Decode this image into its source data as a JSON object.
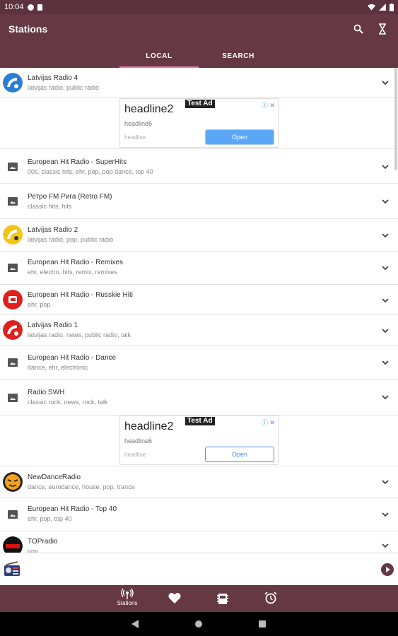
{
  "status_bar": {
    "time": "10:04"
  },
  "app_bar": {
    "title": "Stations"
  },
  "tabs": [
    {
      "label": "LOCAL",
      "active": true
    },
    {
      "label": "SEARCH",
      "active": false
    }
  ],
  "stations": [
    {
      "name": "Latvijas Radio 4",
      "tags": "latvijas radio, public radio",
      "logo": "lr4-logo"
    },
    {
      "name": "European Hit Radio - SuperHits",
      "tags": "00s, classic hits, ehr, pop, pop dance, top 40",
      "logo": "image-placeholder-icon"
    },
    {
      "name": "Ретро FM Рига (Retro FM)",
      "tags": "classic hits, hits",
      "logo": "image-placeholder-icon"
    },
    {
      "name": "Latvijas Radio 2",
      "tags": "latvijas radio, pop, public radio",
      "logo": "lr2-logo"
    },
    {
      "name": "European Hit Radio - Remixes",
      "tags": "ehr, electro, hits, remix, remixes",
      "logo": "image-placeholder-icon"
    },
    {
      "name": "European Hit Radio - Russkie Hiti",
      "tags": "ehr, pop",
      "logo": "ehr-logo"
    },
    {
      "name": "Latvijas Radio 1",
      "tags": "latvijas radio, news, public radio, talk",
      "logo": "lr1-logo"
    },
    {
      "name": "European Hit Radio - Dance",
      "tags": "dance, ehr, electronic",
      "logo": "image-placeholder-icon"
    },
    {
      "name": "Radio SWH",
      "tags": "classic rock, news, rock, talk",
      "logo": "image-placeholder-icon"
    },
    {
      "name": "NewDanceRadio",
      "tags": "dance, eurodance, house, pop, trance",
      "logo": "newdance-logo"
    },
    {
      "name": "European Hit Radio - Top 40",
      "tags": "ehr, pop, top 40",
      "logo": "image-placeholder-icon"
    },
    {
      "name": "TOPradio",
      "tags": "pop",
      "logo": "topradio-logo"
    }
  ],
  "ads": [
    {
      "headline": "headline2",
      "badge": "Test Ad",
      "subtext": "headline6",
      "caption": "headline",
      "button": "Open"
    },
    {
      "headline": "headline2",
      "badge": "Test Ad",
      "subtext": "headline6",
      "caption": "headline",
      "button": "Open"
    }
  ],
  "bottom_nav": {
    "stations_label": "Stations"
  },
  "colors": {
    "primary": "#653844",
    "status": "#5b323e",
    "tab_indicator": "#e97aa8",
    "ad_blue": "#4a90e2"
  }
}
